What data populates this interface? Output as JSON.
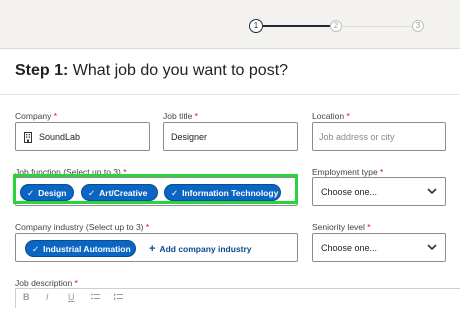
{
  "stepper": {
    "steps": [
      {
        "label": "1",
        "state": "active"
      },
      {
        "label": "2",
        "state": "inactive"
      },
      {
        "label": "3",
        "state": "inactive"
      }
    ]
  },
  "header": {
    "step_prefix": "Step 1:",
    "title": " What job do you want to post?"
  },
  "form": {
    "required_mark": "*",
    "company": {
      "label": "Company",
      "value": "SoundLab"
    },
    "job_title": {
      "label": "Job title",
      "value": "Designer"
    },
    "location": {
      "label": "Location",
      "placeholder": "Job address or city"
    },
    "job_function": {
      "label": "Job function (Select up to 3)",
      "chips": [
        "Design",
        "Art/Creative",
        "Information Technology"
      ]
    },
    "employment_type": {
      "label": "Employment type",
      "value": "Choose one..."
    },
    "company_industry": {
      "label": "Company industry (Select up to 3)",
      "chips": [
        "Industrial Automation"
      ],
      "add_label": "Add company industry"
    },
    "seniority_level": {
      "label": "Seniority level",
      "value": "Choose one..."
    },
    "job_description": {
      "label": "Job description",
      "toolbar": [
        "B",
        "I",
        "U",
        "bulleted-list-icon",
        "numbered-list-icon"
      ]
    }
  },
  "colors": {
    "accent": "#0a66c2",
    "highlight": "#29d33b",
    "required": "#cc1016"
  }
}
